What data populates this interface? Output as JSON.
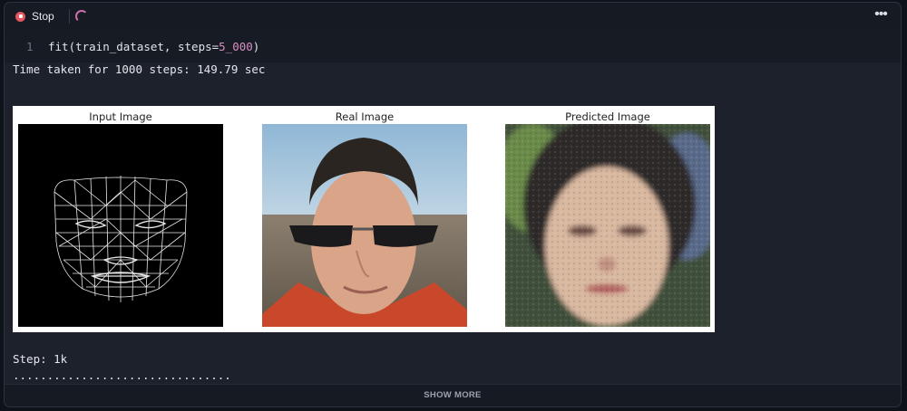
{
  "toolbar": {
    "stop_label": "Stop"
  },
  "editor": {
    "line_number": "1",
    "code_fn": "fit(train_dataset, steps=",
    "code_num": "5_000",
    "code_end": ")"
  },
  "output": {
    "time_line": "Time taken for 1000 steps: 149.79 sec",
    "step_line": "Step: 1k",
    "progress_dots": "................................"
  },
  "figure": {
    "titles": [
      "Input Image",
      "Real Image",
      "Predicted Image"
    ]
  },
  "footer": {
    "show_more_label": "SHOW MORE"
  },
  "colors": {
    "cell_bg": "#1c212b",
    "stop_red": "#e5565f",
    "spinner": "#c96fa8",
    "number_literal": "#d98fc4"
  }
}
